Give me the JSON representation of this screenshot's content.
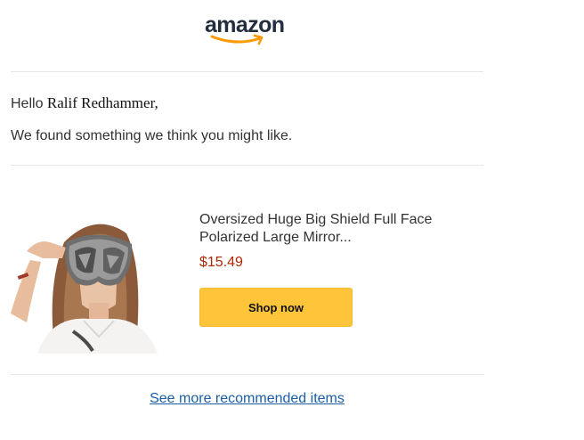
{
  "header": {
    "logo_text": "amazon",
    "logo_color": "#232f3e",
    "smile_color": "#ff9900"
  },
  "greeting": {
    "hello": "Hello ",
    "name": "Ralif Redhammer,",
    "intro": "We found something we think you might like."
  },
  "product": {
    "title": "Oversized Huge Big Shield Full Face Polarized Large Mirror...",
    "price": "$15.49",
    "price_color": "#b12704",
    "button_label": "Shop now",
    "button_color": "#fec53a",
    "image_icon": "product-photo-woman-mirror-sunglasses"
  },
  "footer": {
    "see_more_label": "See more recommended items",
    "link_color": "#1a5fa6"
  }
}
